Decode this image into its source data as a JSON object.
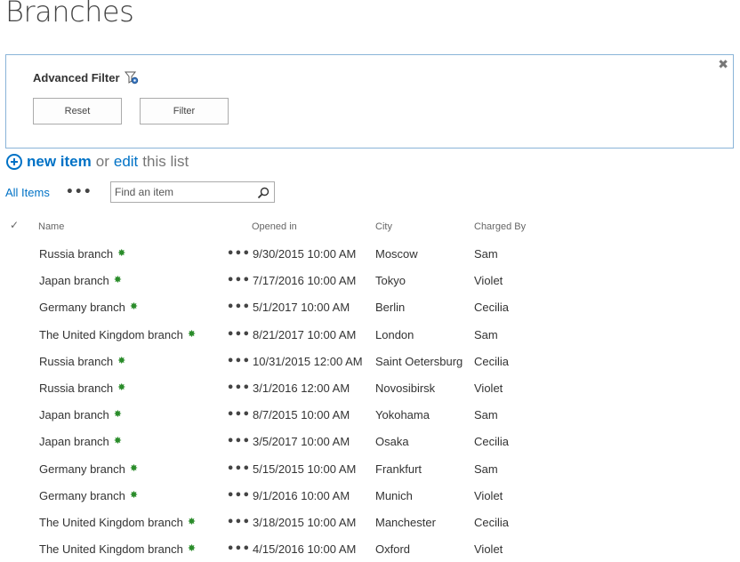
{
  "page": {
    "title": "Branches"
  },
  "filter": {
    "heading": "Advanced Filter",
    "reset_label": "Reset",
    "filter_label": "Filter",
    "close_glyph": "✖"
  },
  "toolbar": {
    "new_item": "new item",
    "or_text": "or",
    "edit": "edit",
    "this_list": "this list"
  },
  "views": {
    "current": "All Items",
    "more": "•••",
    "search_placeholder": "Find an item"
  },
  "table": {
    "check_glyph": "✓",
    "columns": {
      "name": "Name",
      "opened": "Opened in",
      "city": "City",
      "charged": "Charged By"
    },
    "rows": [
      {
        "name": "Russia branch",
        "opened": "9/30/2015 10:00 AM",
        "city": "Moscow",
        "charged": "Sam"
      },
      {
        "name": "Japan branch",
        "opened": "7/17/2016 10:00 AM",
        "city": "Tokyo",
        "charged": "Violet"
      },
      {
        "name": "Germany branch",
        "opened": "5/1/2017 10:00 AM",
        "city": "Berlin",
        "charged": "Cecilia"
      },
      {
        "name": "The United Kingdom branch",
        "opened": "8/21/2017 10:00 AM",
        "city": "London",
        "charged": "Sam"
      },
      {
        "name": "Russia branch",
        "opened": "10/31/2015 12:00 AM",
        "city": "Saint Oetersburg",
        "charged": "Cecilia"
      },
      {
        "name": "Russia branch",
        "opened": "3/1/2016 12:00 AM",
        "city": "Novosibirsk",
        "charged": "Violet"
      },
      {
        "name": "Japan branch",
        "opened": "8/7/2015 10:00 AM",
        "city": "Yokohama",
        "charged": "Sam"
      },
      {
        "name": "Japan branch",
        "opened": "3/5/2017 10:00 AM",
        "city": "Osaka",
        "charged": "Cecilia"
      },
      {
        "name": "Germany branch",
        "opened": "5/15/2015 10:00 AM",
        "city": "Frankfurt",
        "charged": "Sam"
      },
      {
        "name": "Germany branch",
        "opened": "9/1/2016 10:00 AM",
        "city": "Munich",
        "charged": "Violet"
      },
      {
        "name": "The United Kingdom branch",
        "opened": "3/18/2015 10:00 AM",
        "city": "Manchester",
        "charged": "Cecilia"
      },
      {
        "name": "The United Kingdom branch",
        "opened": "4/15/2016 10:00 AM",
        "city": "Oxford",
        "charged": "Violet"
      }
    ],
    "new_glyph": "✸",
    "row_more": "•••"
  },
  "colors": {
    "accent": "#0072c6",
    "panel_border": "#8ab4d8",
    "new_badge": "#2a8c2a"
  }
}
